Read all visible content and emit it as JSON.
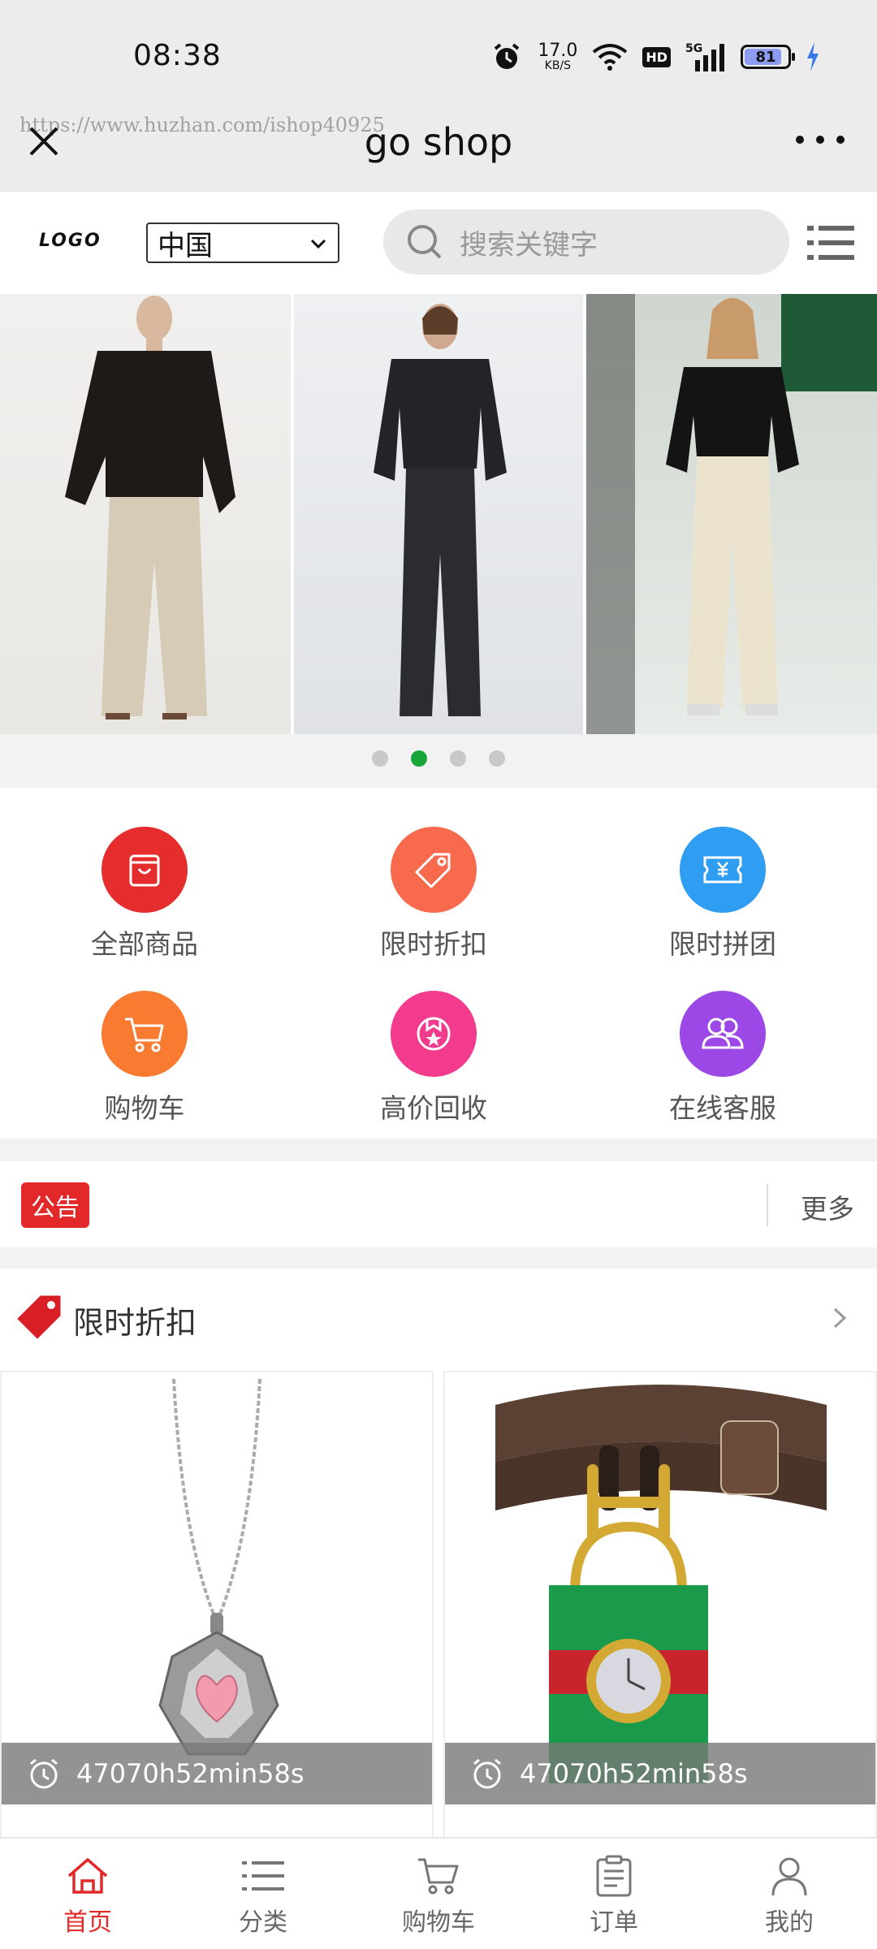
{
  "status_bar": {
    "time": "08:38",
    "net_speed_value": "17.0",
    "net_speed_unit": "KB/S",
    "hd": "HD",
    "network": "5G",
    "battery": "81"
  },
  "title_bar": {
    "watermark": "https://www.huzhan.com/ishop40925",
    "title": "go shop"
  },
  "header": {
    "logo": "LOGO",
    "region": "中国",
    "search_placeholder": "搜索关键字"
  },
  "banner": {
    "slide_count": 4,
    "active_slide": 2
  },
  "quick_nav": [
    {
      "label": "全部商品",
      "color": "#e52d2d",
      "icon": "bag-icon"
    },
    {
      "label": "限时折扣",
      "color": "#f86a4d",
      "icon": "tag-icon"
    },
    {
      "label": "限时拼团",
      "color": "#2f9ef2",
      "icon": "ticket-yen-icon"
    },
    {
      "label": "购物车",
      "color": "#f97a31",
      "icon": "cart-icon"
    },
    {
      "label": "高价回收",
      "color": "#f23b8c",
      "icon": "recycle-badge-icon"
    },
    {
      "label": "在线客服",
      "color": "#9c48e6",
      "icon": "users-icon"
    }
  ],
  "notice": {
    "tag": "公告",
    "more": "更多"
  },
  "flash_sale": {
    "title": "限时折扣",
    "products": [
      {
        "countdown": "47070h52min58s",
        "image": "pendant-necklace"
      },
      {
        "countdown": "47070h52min58s",
        "image": "padlock-bracelet-watch"
      }
    ]
  },
  "tab_bar": [
    {
      "label": "首页",
      "icon": "home-icon",
      "active": true
    },
    {
      "label": "分类",
      "icon": "list-icon",
      "active": false
    },
    {
      "label": "购物车",
      "icon": "cart-icon",
      "active": false
    },
    {
      "label": "订单",
      "icon": "clipboard-icon",
      "active": false
    },
    {
      "label": "我的",
      "icon": "user-icon",
      "active": false
    }
  ],
  "colors": {
    "accent": "#e22828",
    "dot_active": "#19a53a"
  }
}
